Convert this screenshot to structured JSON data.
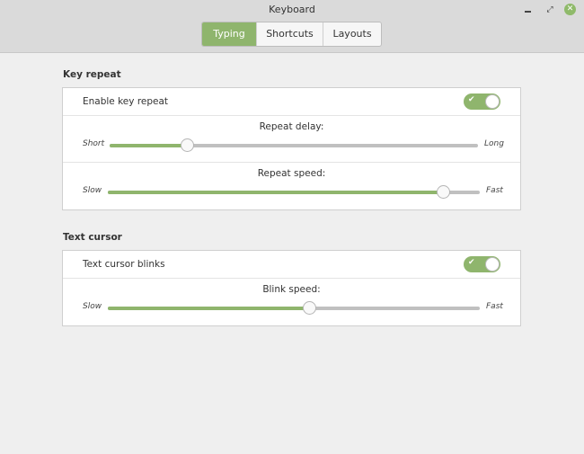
{
  "window": {
    "title": "Keyboard",
    "controls": {
      "minimize_icon": "–",
      "maximize_icon": "⤢",
      "close_icon": "✕"
    }
  },
  "tabs": [
    {
      "label": "Typing",
      "active": true
    },
    {
      "label": "Shortcuts",
      "active": false
    },
    {
      "label": "Layouts",
      "active": false
    }
  ],
  "colors": {
    "accent": "#8fb56d",
    "track": "#c0c0c0"
  },
  "key_repeat": {
    "title": "Key repeat",
    "enable": {
      "label": "Enable key repeat",
      "on": true,
      "check_icon": "✔"
    },
    "repeat_delay": {
      "caption": "Repeat delay:",
      "min_label": "Short",
      "max_label": "Long",
      "value": 0.21
    },
    "repeat_speed": {
      "caption": "Repeat speed:",
      "min_label": "Slow",
      "max_label": "Fast",
      "value": 0.9
    }
  },
  "text_cursor": {
    "title": "Text cursor",
    "blinks": {
      "label": "Text cursor blinks",
      "on": true,
      "check_icon": "✔"
    },
    "blink_speed": {
      "caption": "Blink speed:",
      "min_label": "Slow",
      "max_label": "Fast",
      "value": 0.54
    }
  }
}
